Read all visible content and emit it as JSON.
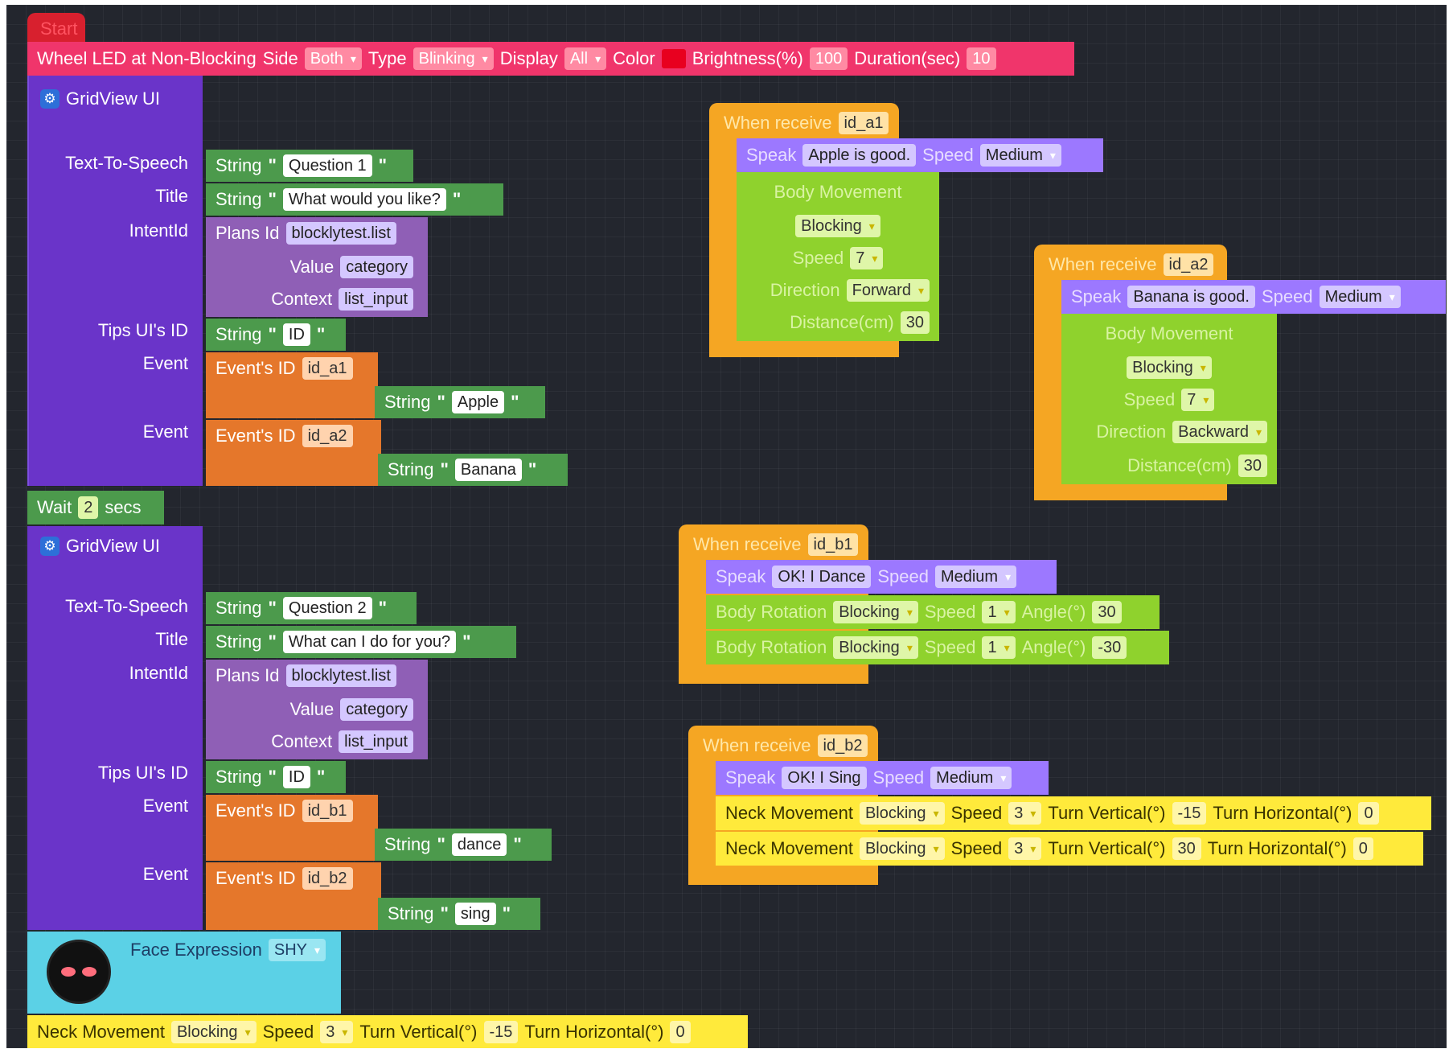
{
  "start_label": "Start",
  "wheel_led": {
    "title": "Wheel LED at Non-Blocking",
    "side_label": "Side",
    "side_value": "Both",
    "type_label": "Type",
    "type_value": "Blinking",
    "display_label": "Display",
    "display_value": "All",
    "color_label": "Color",
    "color_hex": "#e8001f",
    "brightness_label": "Brightness(%)",
    "brightness_value": "100",
    "duration_label": "Duration(sec)",
    "duration_value": "10"
  },
  "labels": {
    "gridview": "GridView UI",
    "tts": "Text-To-Speech",
    "title": "Title",
    "intentid": "IntentId",
    "tips": "Tips UI's ID",
    "event": "Event",
    "string": "String",
    "plans_id": "Plans Id",
    "value": "Value",
    "context": "Context",
    "events_id": "Event's ID",
    "when_receive": "When receive",
    "speak": "Speak",
    "speed": "Speed",
    "body_movement": "Body Movement",
    "direction": "Direction",
    "distance": "Distance(cm)",
    "body_rotation": "Body Rotation",
    "angle": "Angle(°)",
    "neck_movement": "Neck Movement",
    "turn_vertical": "Turn Vertical(°)",
    "turn_horizontal": "Turn Horizontal(°)",
    "face_expression": "Face Expression",
    "wait": "Wait",
    "secs": "secs",
    "quote": "\""
  },
  "gridview1": {
    "tts": "Question 1",
    "title": "What would you like?",
    "plans_id": "blocklytest.list",
    "value": "category",
    "context": "list_input",
    "tips": "ID",
    "event1_id": "id_a1",
    "event1_str": "Apple",
    "event2_id": "id_a2",
    "event2_str": "Banana"
  },
  "wait_secs": "2",
  "gridview2": {
    "tts": "Question 2",
    "title": "What can I do for you?",
    "plans_id": "blocklytest.list",
    "value": "category",
    "context": "list_input",
    "tips": "ID",
    "event1_id": "id_b1",
    "event1_str": "dance",
    "event2_id": "id_b2",
    "event2_str": "sing"
  },
  "face_expression_value": "SHY",
  "neck_main": {
    "mode": "Blocking",
    "speed": "3",
    "vertical": "-15",
    "horizontal": "0"
  },
  "recv_a1": {
    "id": "id_a1",
    "speak": "Apple is good.",
    "speed": "Medium",
    "body_mode": "Blocking",
    "body_speed": "7",
    "direction": "Forward",
    "distance": "30"
  },
  "recv_a2": {
    "id": "id_a2",
    "speak": "Banana is good.",
    "speed": "Medium",
    "body_mode": "Blocking",
    "body_speed": "7",
    "direction": "Backward",
    "distance": "30"
  },
  "recv_b1": {
    "id": "id_b1",
    "speak": "OK! I Dance",
    "speed": "Medium",
    "rot1_mode": "Blocking",
    "rot1_speed": "1",
    "rot1_angle": "30",
    "rot2_mode": "Blocking",
    "rot2_speed": "1",
    "rot2_angle": "-30"
  },
  "recv_b2": {
    "id": "id_b2",
    "speak": "OK! I Sing",
    "speed": "Medium",
    "n1_mode": "Blocking",
    "n1_speed": "3",
    "n1_vertical": "-15",
    "n1_horizontal": "0",
    "n2_mode": "Blocking",
    "n2_speed": "3",
    "n2_vertical": "30",
    "n2_horizontal": "0"
  }
}
